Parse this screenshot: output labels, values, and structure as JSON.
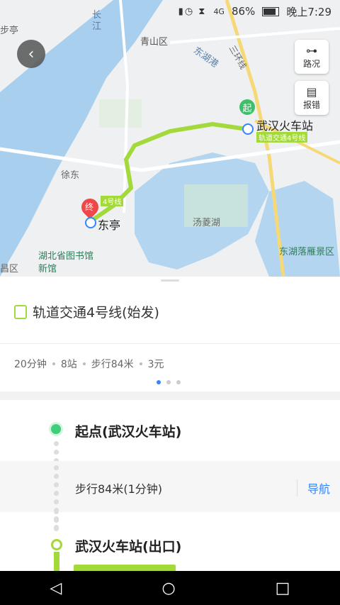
{
  "status_bar": {
    "battery": "86%",
    "time": "晚上7:29",
    "network": "4G"
  },
  "map": {
    "labels": {
      "top_left": "步亭",
      "changjiang": "长江",
      "qingshan": "青山区",
      "donghu_gang": "东湖港",
      "sanhuan": "三环线",
      "xudong": "徐东",
      "tangling": "汤菱湖",
      "library": "湖北省图书馆",
      "library_sub": "新馆",
      "qu": "昌区",
      "scenic": "东湖落雁景区"
    },
    "start_badge": "起",
    "end_badge": "终",
    "start_station": "武汉火车站",
    "end_station": "东亭",
    "line_tag": "轨道交通4号线",
    "line_tag_short": "4号线",
    "colors": {
      "route": "#a4d93c",
      "start": "#3fbf6a",
      "end": "#f04848",
      "water": "#a9cfee"
    }
  },
  "map_buttons": {
    "traffic": {
      "label": "路况",
      "icon": "traffic-icon"
    },
    "report": {
      "label": "报错",
      "icon": "report-icon"
    },
    "back_icon": "back-icon"
  },
  "panel": {
    "route_title": "轨道交通4号线(始发)",
    "summary": {
      "duration": "20分钟",
      "stops": "8站",
      "walk": "步行84米",
      "fare": "3元"
    }
  },
  "steps": {
    "start": "起点(武汉火车站)",
    "walk": "步行84米(1分钟)",
    "walk_nav": "导航",
    "exit": "武汉火车站(出口)"
  },
  "navbar": {
    "back": "◁",
    "home": "○",
    "recent": "□"
  }
}
